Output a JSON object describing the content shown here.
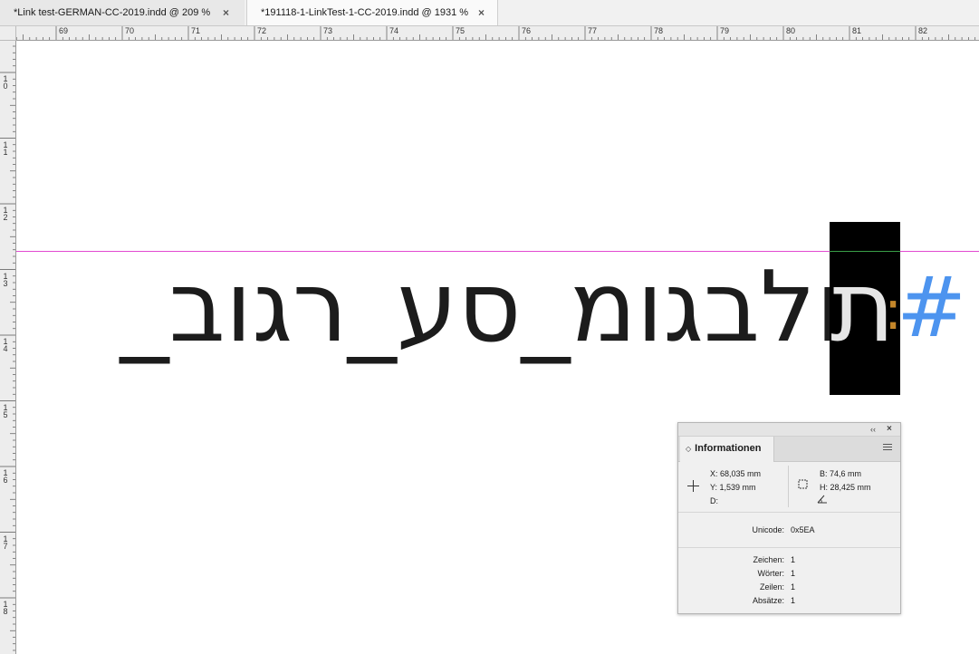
{
  "tabs": [
    {
      "label": "*Link test-GERMAN-CC-2019.indd @ 209 %",
      "close": "×",
      "active": false
    },
    {
      "label": "*191118-1-LinkTest-1-CC-2019.indd @ 1931 %",
      "close": "×",
      "active": true
    }
  ],
  "ruler": {
    "h_labels": [
      "69",
      "70",
      "71",
      "72",
      "73",
      "74",
      "75",
      "76",
      "77",
      "78",
      "79",
      "80",
      "81",
      "82"
    ],
    "v_labels": [
      "1\n0",
      "1\n1",
      "1\n2",
      "1\n3",
      "1\n4",
      "1\n5",
      "1\n6",
      "1\n7",
      "1\n8"
    ]
  },
  "document": {
    "hebrew_text": "תולבגומ_סע_רגוב_",
    "selected_char": "ת",
    "colon_marker": ":",
    "end_marker": "#",
    "colors": {
      "guide": "#e24ad1",
      "hash": "#4d94ef",
      "colon": "#c4862a",
      "selection": "#000000"
    }
  },
  "info_panel": {
    "title": "Informationen",
    "collapse": "‹‹",
    "close": "×",
    "x": "X: 68,035 mm",
    "y": "Y: 1,539 mm",
    "d": "D:",
    "b": "B: 74,6 mm",
    "h": "H: 28,425 mm",
    "unicode_label": "Unicode:",
    "unicode_value": "0x5EA",
    "stats": [
      {
        "label": "Zeichen:",
        "value": "1"
      },
      {
        "label": "Wörter:",
        "value": "1"
      },
      {
        "label": "Zeilen:",
        "value": "1"
      },
      {
        "label": "Absätze:",
        "value": "1"
      }
    ],
    "icons": [
      "crosshair-icon",
      "dimensions-icon",
      "angle-icon",
      "panel-menu-icon"
    ]
  }
}
